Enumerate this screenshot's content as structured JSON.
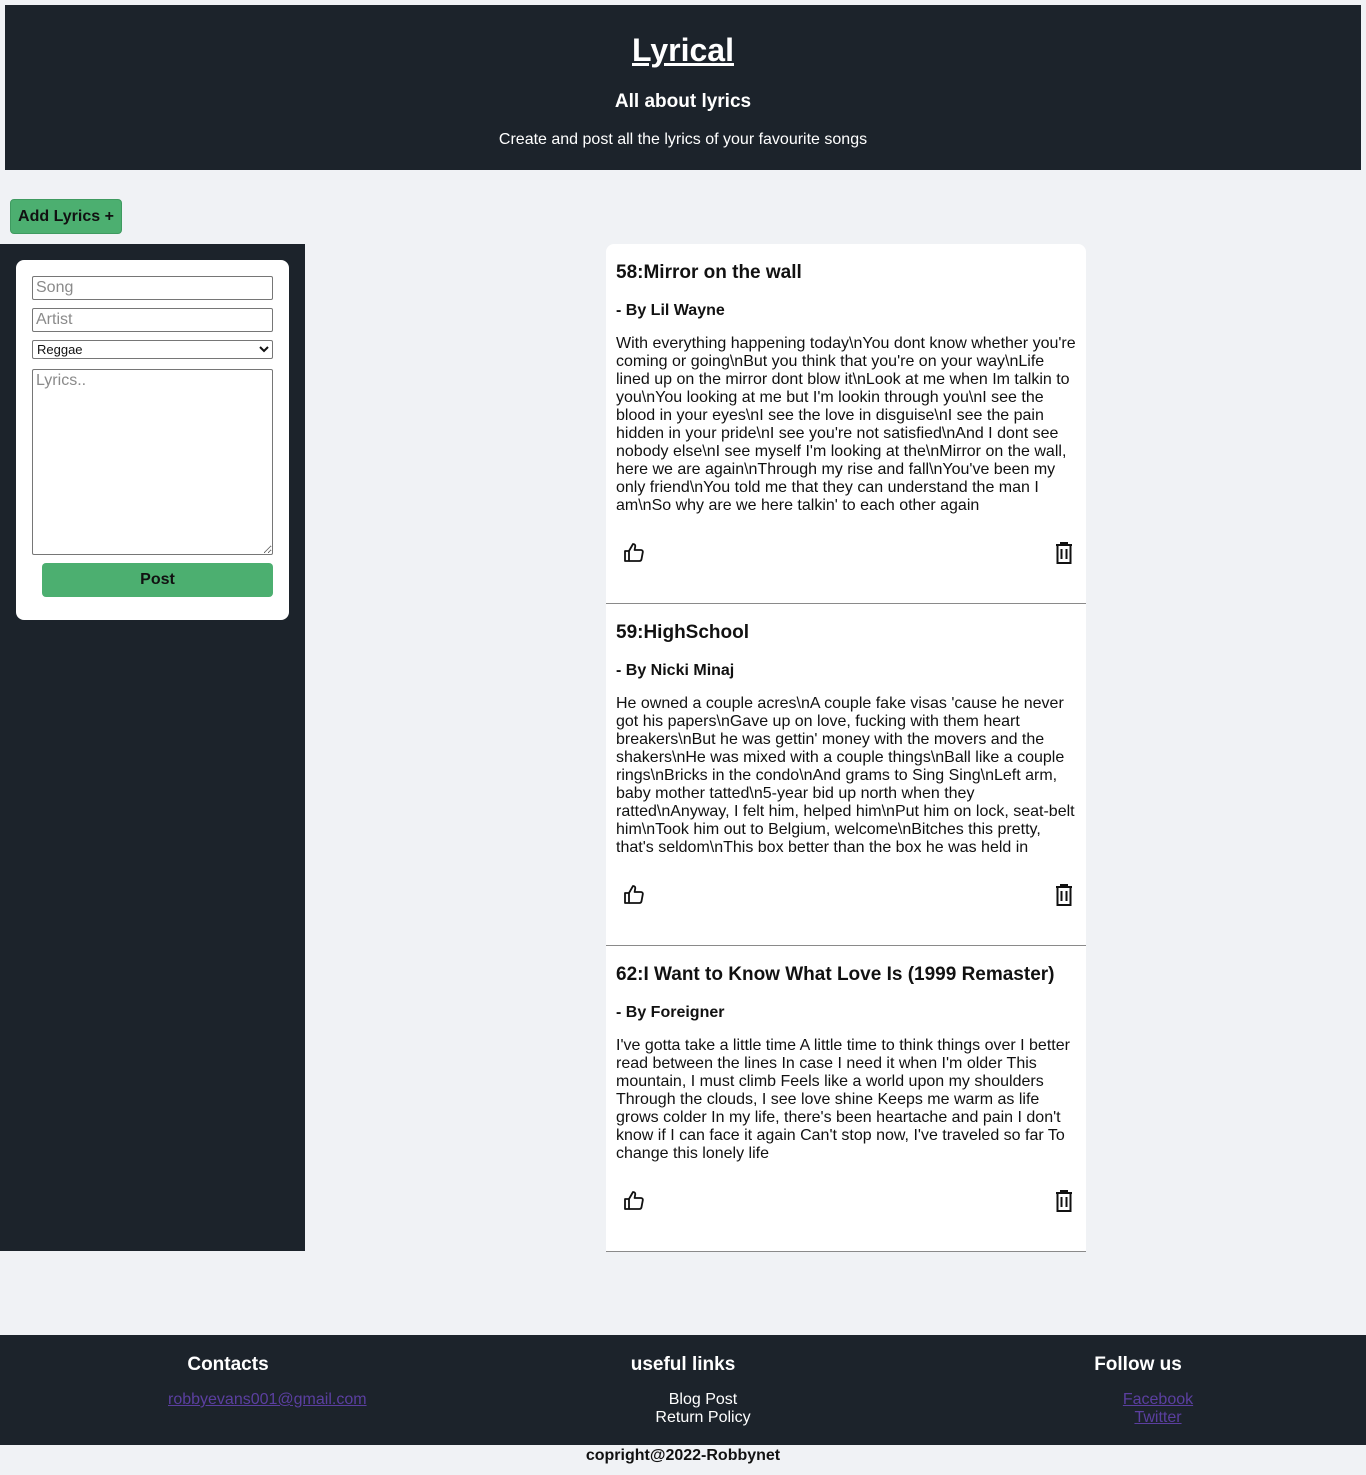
{
  "header": {
    "title": "Lyrical",
    "subtitle": "All about lyrics",
    "tagline": "Create and post all the lyrics of your favourite songs"
  },
  "toolbar": {
    "add_label": "Add Lyrics +"
  },
  "form": {
    "song_placeholder": "Song",
    "artist_placeholder": "Artist",
    "genre_selected": "Reggae",
    "lyrics_placeholder": "Lyrics..",
    "post_label": "Post"
  },
  "posts": [
    {
      "title": "58:Mirror on the wall",
      "artist": "- By Lil Wayne",
      "lyrics": "With everything happening today\\nYou dont know whether you're coming or going\\nBut you think that you're on your way\\nLife lined up on the mirror dont blow it\\nLook at me when Im talkin to you\\nYou looking at me but I'm lookin through you\\nI see the blood in your eyes\\nI see the love in disguise\\nI see the pain hidden in your pride\\nI see you're not satisfied\\nAnd I dont see nobody else\\nI see myself I'm looking at the\\nMirror on the wall, here we are again\\nThrough my rise and fall\\nYou've been my only friend\\nYou told me that they can understand the man I am\\nSo why are we here talkin' to each other again"
    },
    {
      "title": "59:HighSchool",
      "artist": "- By Nicki Minaj",
      "lyrics": "He owned a couple acres\\nA couple fake visas 'cause he never got his papers\\nGave up on love, fucking with them heart breakers\\nBut he was gettin' money with the movers and the shakers\\nHe was mixed with a couple things\\nBall like a couple rings\\nBricks in the condo\\nAnd grams to Sing Sing\\nLeft arm, baby mother tatted\\n5-year bid up north when they ratted\\nAnyway, I felt him, helped him\\nPut him on lock, seat-belt him\\nTook him out to Belgium, welcome\\nBitches this pretty, that's seldom\\nThis box better than the box he was held in"
    },
    {
      "title": "62:I Want to Know What Love Is (1999 Remaster)",
      "artist": "- By Foreigner",
      "lyrics": "I've gotta take a little time A little time to think things over I better read between the lines In case I need it when I'm older This mountain, I must climb Feels like a world upon my shoulders Through the clouds, I see love shine Keeps me warm as life grows colder In my life, there's been heartache and pain I don't know if I can face it again Can't stop now, I've traveled so far To change this lonely life"
    }
  ],
  "footer": {
    "contacts_heading": "Contacts",
    "email": "robbyevans001@gmail.com",
    "links_heading": "useful links",
    "link_blog": "Blog Post",
    "link_return": "Return Policy",
    "follow_heading": "Follow us",
    "facebook": "Facebook",
    "twitter": "Twitter"
  },
  "copyright": "copright@2022-Robbynet",
  "icons": {
    "like": "thumbs-up-icon",
    "delete": "trash-icon"
  }
}
